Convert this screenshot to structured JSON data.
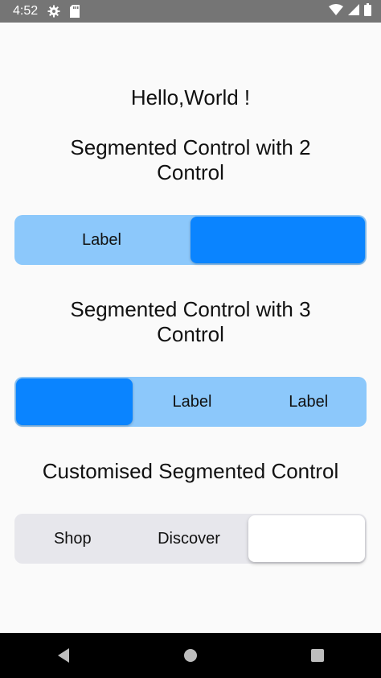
{
  "status_bar": {
    "time": "4:52",
    "icons": [
      "gear-icon",
      "sd-card-icon",
      "wifi-icon",
      "signal-icon",
      "battery-icon"
    ]
  },
  "hello": "Hello,World !",
  "section1": {
    "title_line1": "Segmented Control with 2",
    "title_line2": "Control",
    "segments": [
      "Label",
      ""
    ],
    "selected_index": 1
  },
  "section2": {
    "title_line1": "Segmented Control with 3",
    "title_line2": "Control",
    "segments": [
      "",
      "Label",
      "Label"
    ],
    "selected_index": 0
  },
  "section3": {
    "title": "Customised Segmented Control",
    "segments": [
      "Shop",
      "Discover",
      ""
    ],
    "selected_index": 2
  },
  "colors": {
    "accent": "#0a84ff",
    "track_blue": "#8cc8fb",
    "track_grey": "#e7e7ec"
  },
  "nav_bar": {
    "buttons": [
      "back-icon",
      "home-icon",
      "recents-icon"
    ]
  }
}
